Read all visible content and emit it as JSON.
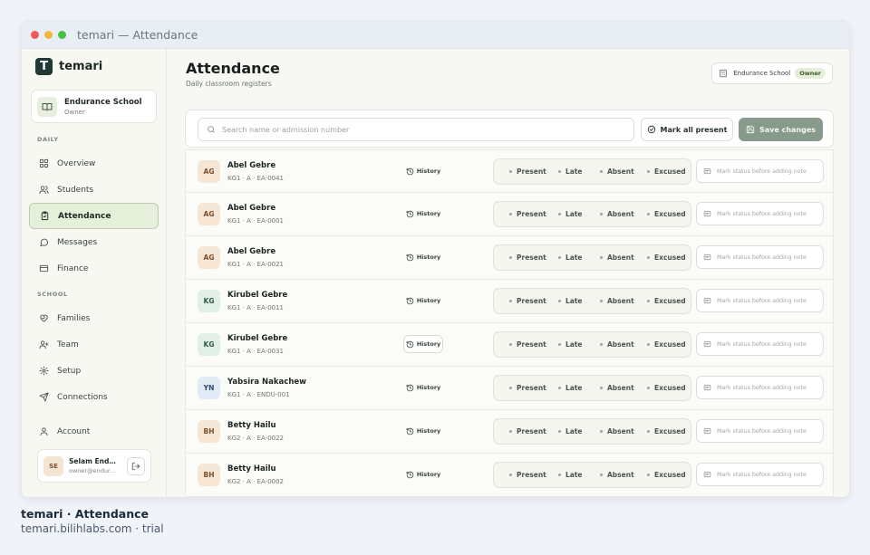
{
  "window": {
    "title": "temari — Attendance"
  },
  "brand": {
    "name": "temari",
    "logo_letter": "T"
  },
  "school": {
    "name": "Endurance School",
    "role": "Owner"
  },
  "sidebar": {
    "daily_label": "DAILY",
    "daily_items": [
      {
        "label": "Overview",
        "icon": "grid-icon"
      },
      {
        "label": "Students",
        "icon": "users-icon"
      },
      {
        "label": "Attendance",
        "icon": "clipboard-check-icon",
        "active": true
      },
      {
        "label": "Messages",
        "icon": "chat-icon"
      },
      {
        "label": "Finance",
        "icon": "wallet-icon"
      }
    ],
    "school_label": "SCHOOL",
    "school_items": [
      {
        "label": "Families",
        "icon": "heart-handshake-icon"
      },
      {
        "label": "Team",
        "icon": "user-plus-icon"
      },
      {
        "label": "Setup",
        "icon": "gear-icon"
      },
      {
        "label": "Connections",
        "icon": "send-icon"
      }
    ],
    "account_label": "Account"
  },
  "user": {
    "initials": "SE",
    "name": "Selam Endurance",
    "email": "owner@endurance.school"
  },
  "header": {
    "title": "Attendance",
    "subtitle": "Daily classroom registers",
    "school_chip": "Endurance School",
    "owner_badge": "Owner"
  },
  "toolbar": {
    "search_placeholder": "Search name or admission number",
    "mark_all_label": "Mark all present",
    "save_label": "Save changes"
  },
  "status_options": [
    "Present",
    "Late",
    "Absent",
    "Excused"
  ],
  "history_label": "History",
  "note_placeholder": "Mark status before adding note",
  "students": [
    {
      "initials": "AG",
      "name": "Abel Gebre",
      "meta": "KG1 · A · EA-0041"
    },
    {
      "initials": "AG",
      "name": "Abel Gebre",
      "meta": "KG1 · A · EA-0001"
    },
    {
      "initials": "AG",
      "name": "Abel Gebre",
      "meta": "KG1 · A · EA-0021"
    },
    {
      "initials": "KG",
      "name": "Kirubel Gebre",
      "meta": "KG1 · A · EA-0011"
    },
    {
      "initials": "KG",
      "name": "Kirubel Gebre",
      "meta": "KG1 · A · EA-0031"
    },
    {
      "initials": "YN",
      "name": "Yabsira Nakachew",
      "meta": "KG1 · A · ENDU-001"
    },
    {
      "initials": "BH",
      "name": "Betty Hailu",
      "meta": "KG2 · A · EA-0022"
    },
    {
      "initials": "BH",
      "name": "Betty Hailu",
      "meta": "KG2 · A · EA-0002"
    }
  ],
  "avatar_colors": {
    "AG": {
      "bg": "#f5e6d6",
      "fg": "#7a4f2c"
    },
    "KG": {
      "bg": "#e0efe7",
      "fg": "#2f5a45"
    },
    "YN": {
      "bg": "#e1ebf5",
      "fg": "#2f4c6c"
    },
    "BH": {
      "bg": "#f5e6d6",
      "fg": "#7a4f2c"
    }
  },
  "caption": {
    "title": "temari · Attendance",
    "subtitle": "temari.bilihlabs.com · trial"
  }
}
